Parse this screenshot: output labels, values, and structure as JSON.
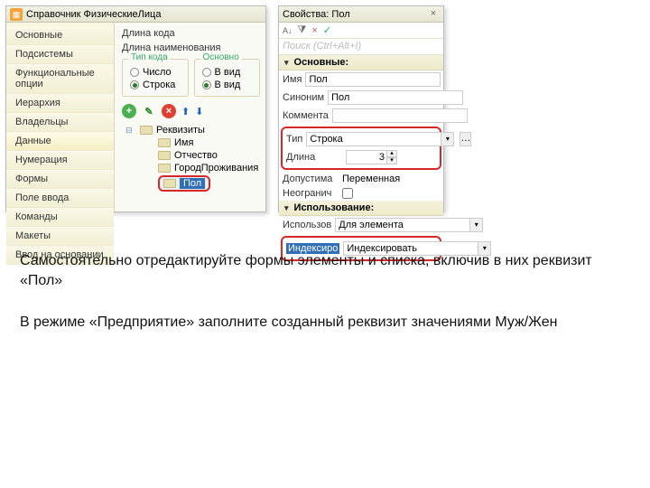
{
  "left": {
    "title": "Справочник ФизическиеЛица",
    "sidebar": [
      "Основные",
      "Подсистемы",
      "Функциональные опции",
      "Иерархия",
      "Владельцы",
      "Данные",
      "Нумерация",
      "Формы",
      "Поле ввода",
      "Команды",
      "Макеты",
      "Ввод на основании"
    ],
    "sidebar_active_index": 5,
    "len_code": "Длина кода",
    "len_name": "Длина наименования",
    "group_type": "Тип кода",
    "radio_number": "Число",
    "radio_string": "Строка",
    "group_main": "Основно",
    "radio_vid1": "В вид",
    "radio_vid2": "В вид",
    "tree": {
      "root": "Реквизиты",
      "children": [
        "Имя",
        "Отчество",
        "ГородПроживания",
        "Пол"
      ]
    }
  },
  "right": {
    "title": "Свойства: Пол",
    "search_ph": "Поиск (Ctrl+Alt+I)",
    "section_main": "Основные:",
    "lbl_name": "Имя",
    "val_name": "Пол",
    "lbl_syn": "Синоним",
    "val_syn": "Пол",
    "lbl_comment": "Коммента",
    "lbl_type": "Тип",
    "val_type": "Строка",
    "lbl_len": "Длина",
    "val_len": "3",
    "lbl_allow": "Допустима",
    "val_allow": "Переменная",
    "lbl_nonneg": "Неогранич",
    "section_use": "Использование:",
    "lbl_use": "Использов",
    "val_use": "Для элемента",
    "lbl_index": "Индексиро",
    "val_index": "Индексировать"
  },
  "text1": "Самостоятельно отредактируйте формы элементы и списка, включив в них реквизит «Пол»",
  "text2": "В режиме «Предприятие» заполните созданный реквизит значениями Муж/Жен"
}
